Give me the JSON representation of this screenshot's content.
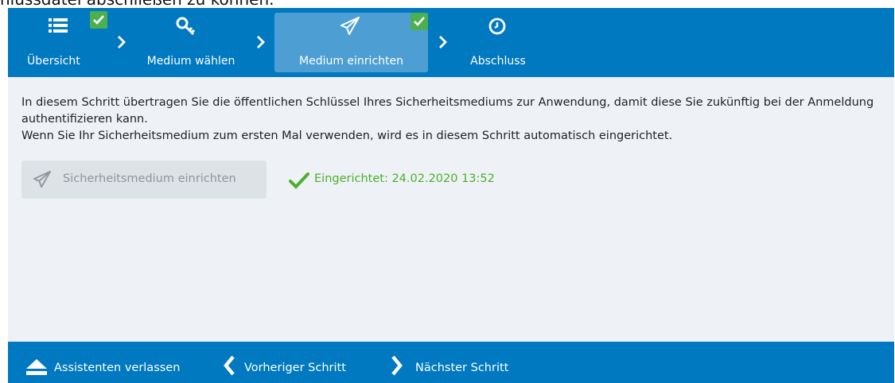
{
  "page_top_text": "nlussdatei abschließen zu können.",
  "steps": [
    {
      "label": "Übersicht",
      "icon": "list-icon",
      "completed": true,
      "active": false
    },
    {
      "label": "Medium wählen",
      "icon": "key-icon",
      "completed": false,
      "active": false
    },
    {
      "label": "Medium einrichten",
      "icon": "paper-plane-icon",
      "completed": true,
      "active": true
    },
    {
      "label": "Abschluss",
      "icon": "clock-icon",
      "completed": false,
      "active": false
    }
  ],
  "content": {
    "description_line1": "In diesem Schritt übertragen Sie die öffentlichen Schlüssel Ihres Sicherheitsmediums zur Anwendung, damit diese Sie zukünftig bei der Anmeldung authentifizieren kann.",
    "description_line2": "Wenn Sie Ihr Sicherheitsmedium zum ersten Mal verwenden, wird es in diesem Schritt automatisch eingerichtet.",
    "setup_button_label": "Sicherheitsmedium einrichten",
    "status_text": "Eingerichtet: 24.02.2020 13:52"
  },
  "footer": {
    "exit_label": "Assistenten verlassen",
    "prev_label": "Vorheriger Schritt",
    "next_label": "Nächster Schritt"
  },
  "colors": {
    "header_blue": "#0079c1",
    "active_step": "#4d9fd3",
    "check_green": "#4caf50",
    "status_green": "#4caf2a",
    "content_bg": "#eef2f6"
  }
}
